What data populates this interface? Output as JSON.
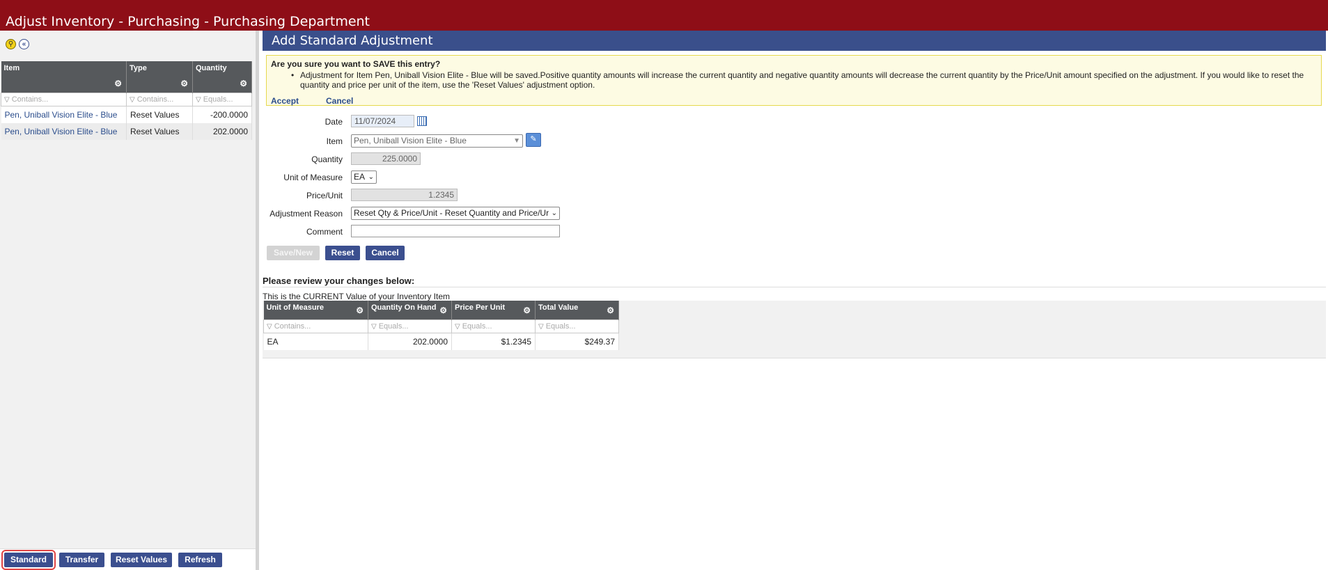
{
  "window": {
    "title": "Adjust Inventory - Purchasing - Purchasing Department"
  },
  "left_grid": {
    "columns": [
      "Item",
      "Type",
      "Quantity"
    ],
    "filters": [
      "Contains...",
      "Contains...",
      "Equals..."
    ],
    "rows": [
      {
        "item": "Pen, Uniball Vision Elite - Blue",
        "type": "Reset Values",
        "quantity": "-200.0000"
      },
      {
        "item": "Pen, Uniball Vision Elite - Blue",
        "type": "Reset Values",
        "quantity": "202.0000"
      }
    ]
  },
  "left_buttons": {
    "standard": "Standard",
    "transfer": "Transfer",
    "reset_values": "Reset Values",
    "refresh": "Refresh"
  },
  "panel": {
    "title": "Add Standard Adjustment"
  },
  "confirm": {
    "question": "Are you sure you want to SAVE this entry?",
    "message": "Adjustment for Item Pen, Uniball Vision Elite - Blue will be saved.Positive quantity amounts will increase the current quantity and negative quantity amounts will decrease the current quantity by the Price/Unit amount specified on the adjustment. If you would like to reset the quantity and price per unit of the item, use the 'Reset Values' adjustment option.",
    "accept": "Accept",
    "cancel": "Cancel"
  },
  "form": {
    "date_label": "Date",
    "date_value": "11/07/2024",
    "item_label": "Item",
    "item_value": "Pen, Uniball Vision Elite - Blue",
    "quantity_label": "Quantity",
    "quantity_value": "225.0000",
    "uom_label": "Unit of Measure",
    "uom_value": "EA",
    "price_label": "Price/Unit",
    "price_value": "1.2345",
    "reason_label": "Adjustment Reason",
    "reason_value": "Reset Qty & Price/Unit - Reset Quantity and Price/Ur",
    "comment_label": "Comment",
    "comment_value": ""
  },
  "form_buttons": {
    "save_new": "Save/New",
    "reset": "Reset",
    "cancel": "Cancel"
  },
  "review": {
    "title": "Please review your changes below:",
    "current_label": "This is the CURRENT Value of your Inventory Item",
    "columns": [
      "Unit of Measure",
      "Quantity On Hand",
      "Price Per Unit",
      "Total Value"
    ],
    "filters": [
      "Contains...",
      "Equals...",
      "Equals...",
      "Equals..."
    ],
    "row": {
      "uom": "EA",
      "qty": "202.0000",
      "price": "$1.2345",
      "total": "$249.37"
    }
  },
  "colors": {
    "title_bar": "#8e0e17",
    "header": "#3a4f8b",
    "button": "#3b4f8f"
  }
}
